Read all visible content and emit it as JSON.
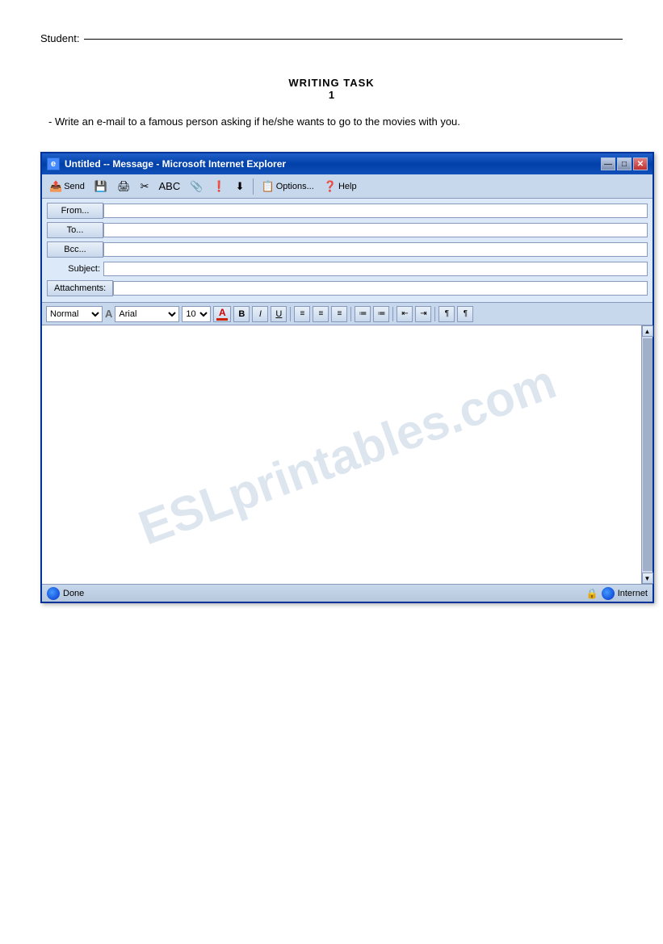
{
  "page": {
    "student_label": "Student:",
    "writing_task": {
      "title": "WRITING TASK",
      "number": "1",
      "instruction": "- Write an e-mail to a famous person asking if he/she wants to go to the movies with you."
    }
  },
  "email_window": {
    "title_bar": {
      "icon": "e",
      "title": "Untitled -- Message - Microsoft Internet Explorer",
      "minimize": "—",
      "maximize": "□",
      "close": "✕"
    },
    "toolbar": {
      "send_label": "Send",
      "options_label": "Options...",
      "help_label": "Help"
    },
    "form": {
      "from_btn": "From...",
      "to_btn": "To...",
      "bcc_btn": "Bcc...",
      "subject_label": "Subject:",
      "attachments_label": "Attachments:",
      "from_value": "",
      "to_value": "",
      "bcc_value": "",
      "subject_value": "",
      "attachments_value": ""
    },
    "format_toolbar": {
      "style_value": "Normal",
      "font_value": "Arial",
      "size_value": "10",
      "bold": "B",
      "italic": "I",
      "underline": "U"
    },
    "watermark": "ESLprintables.com",
    "status": {
      "done_label": "Done",
      "internet_label": "Internet"
    }
  }
}
